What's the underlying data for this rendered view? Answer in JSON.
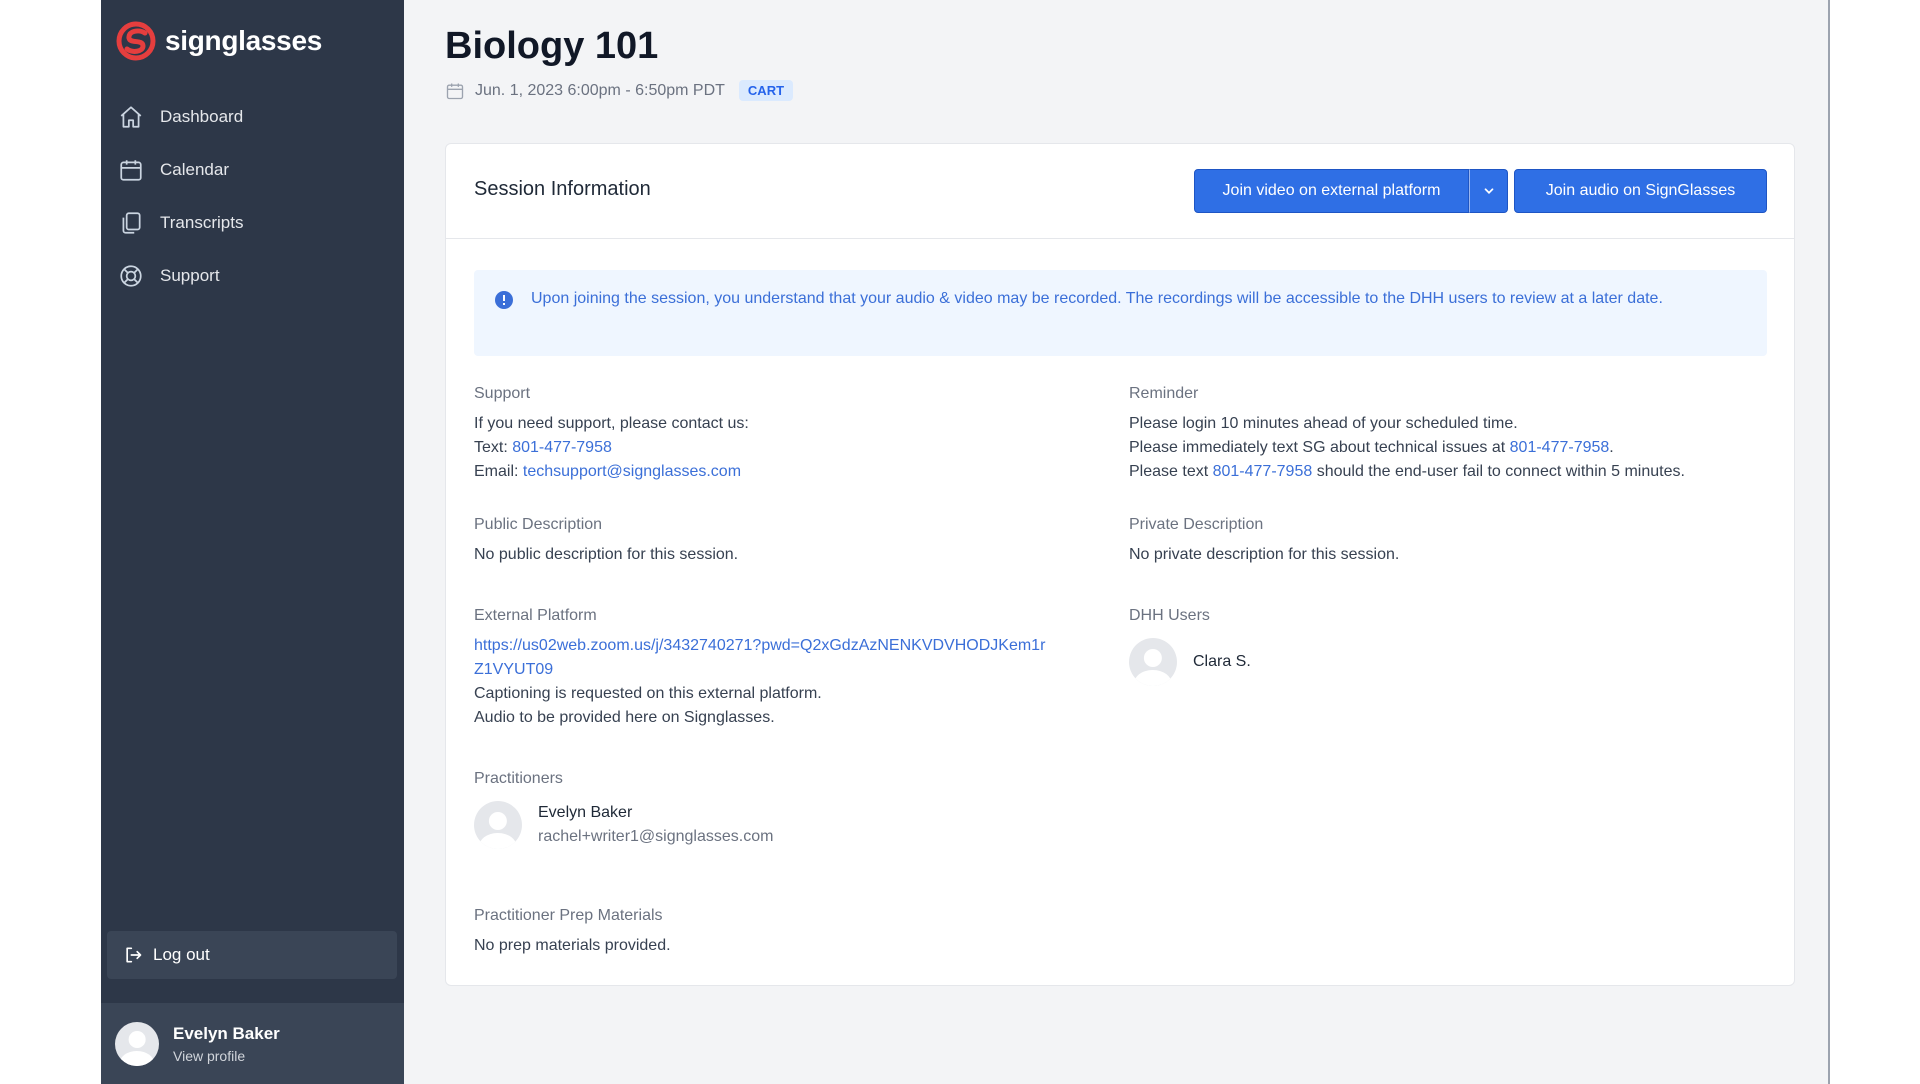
{
  "brand": {
    "name": "signglasses",
    "color": "#e53e3e"
  },
  "sidebar": {
    "items": [
      {
        "label": "Dashboard",
        "icon": "home-icon"
      },
      {
        "label": "Calendar",
        "icon": "calendar-icon"
      },
      {
        "label": "Transcripts",
        "icon": "documents-icon"
      },
      {
        "label": "Support",
        "icon": "lifebuoy-icon"
      }
    ],
    "logout_label": "Log out",
    "profile": {
      "name": "Evelyn Baker",
      "link": "View profile"
    }
  },
  "page": {
    "title": "Biology 101",
    "datetime": "Jun. 1, 2023 6:00pm - 6:50pm PDT",
    "badge": "CART"
  },
  "card": {
    "title": "Session Information",
    "join_video_label": "Join video on external platform",
    "join_audio_label": "Join audio on SignGlasses",
    "notice": "Upon joining the session, you understand that your audio & video may be recorded. The recordings will be accessible to the DHH users to review at a later date."
  },
  "support": {
    "label": "Support",
    "intro": "If you need support, please contact us:",
    "text_prefix": "Text: ",
    "phone": "801-477-7958",
    "email_prefix": "Email: ",
    "email": "techsupport@signglasses.com"
  },
  "reminder": {
    "label": "Reminder",
    "line1": "Please login 10 minutes ahead of your scheduled time.",
    "line2_prefix": "Please immediately text SG about technical issues at ",
    "line2_phone": "801-477-7958",
    "line2_suffix": ".",
    "line3_prefix": "Please text ",
    "line3_phone": "801-477-7958",
    "line3_suffix": " should the end-user fail to connect within 5 minutes."
  },
  "public_description": {
    "label": "Public Description",
    "value": "No public description for this session."
  },
  "private_description": {
    "label": "Private Description",
    "value": "No private description for this session."
  },
  "external_platform": {
    "label": "External Platform",
    "url_line1": "https://us02web.zoom.us/j/3432740271?pwd=Q2xGdzAzNENKVDVHODJKem1r",
    "url_line2": "Z1VYUT09",
    "note1": "Captioning is requested on this external platform.",
    "note2": "Audio to be provided here on Signglasses."
  },
  "dhh_users": {
    "label": "DHH Users",
    "users": [
      {
        "name": "Clara S."
      }
    ]
  },
  "practitioners": {
    "label": "Practitioners",
    "items": [
      {
        "name": "Evelyn Baker",
        "email": "rachel+writer1@signglasses.com"
      }
    ]
  },
  "prep_materials": {
    "label": "Practitioner Prep Materials",
    "value": "No prep materials provided."
  }
}
